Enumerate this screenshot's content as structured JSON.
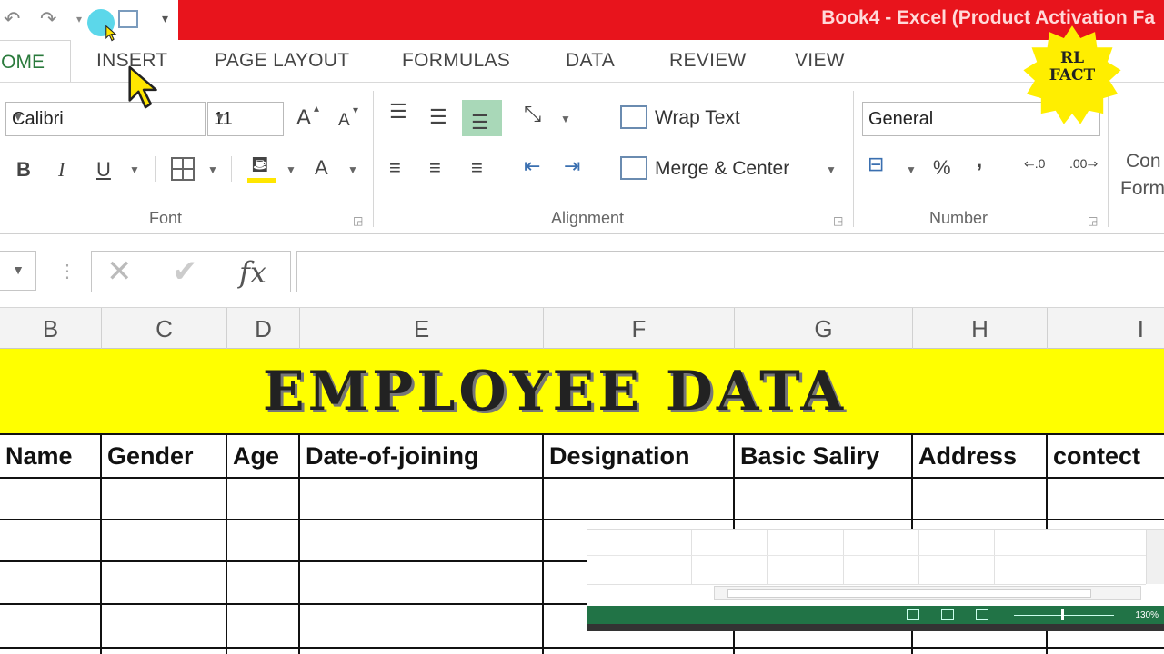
{
  "window": {
    "title": "Book4 -  Excel (Product Activation Fa"
  },
  "tabs": [
    "OME",
    "INSERT",
    "PAGE LAYOUT",
    "FORMULAS",
    "DATA",
    "REVIEW",
    "VIEW"
  ],
  "ribbon": {
    "font_name": "Calibri",
    "font_size": "11",
    "grow_font": "A",
    "shrink_font": "A",
    "bold": "B",
    "italic": "I",
    "underline": "U",
    "font_color": "A",
    "wrap_text": "Wrap Text",
    "merge_center": "Merge & Center",
    "number_format": "General",
    "percent": "%",
    "comma": ",",
    "cond_format_line1": "Con",
    "cond_format_line2": "Form",
    "groups": {
      "font": "Font",
      "alignment": "Alignment",
      "number": "Number"
    }
  },
  "formula_bar": {
    "cancel": "✕",
    "enter": "✔",
    "fx": "fx",
    "value": ""
  },
  "columns": [
    "B",
    "C",
    "D",
    "E",
    "F",
    "G",
    "H",
    "I"
  ],
  "sheet": {
    "banner": "EMPLOYEE DATA",
    "headers": [
      "Name",
      "Gender",
      "Age",
      "Date-of-joining",
      "Designation",
      "Basic Saliry",
      "Address",
      "contect"
    ]
  },
  "watermark": {
    "line1": "RL",
    "line2": "FACT"
  },
  "overlay": {
    "zoom": "130%"
  },
  "colors": {
    "title_bar": "#e8141c",
    "banner": "#ffff00",
    "status_bar": "#217346",
    "accent": "#2a7a3c"
  }
}
